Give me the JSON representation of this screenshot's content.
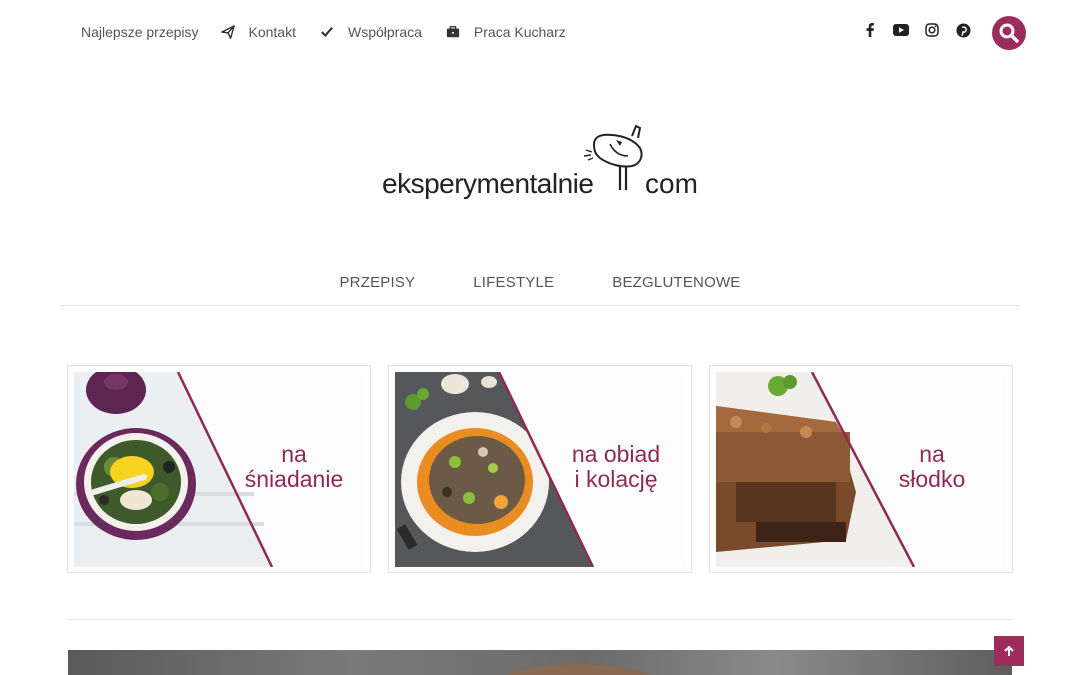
{
  "topnav": {
    "items": [
      {
        "label": "Najlepsze przepisy",
        "icon": "none"
      },
      {
        "label": "Kontakt",
        "icon": "paper-plane-icon"
      },
      {
        "label": "Współpraca",
        "icon": "check-icon"
      },
      {
        "label": "Praca Kucharz",
        "icon": "briefcase-icon"
      }
    ]
  },
  "social": [
    "facebook-icon",
    "youtube-icon",
    "instagram-icon",
    "pinterest-icon"
  ],
  "logo": {
    "text": "eksperymentalnie",
    "suffix": "com"
  },
  "mainnav": {
    "items": [
      "PRZEPISY",
      "LIFESTYLE",
      "BEZGLUTENOWE"
    ]
  },
  "cards": [
    {
      "line1": "na",
      "line2": "śniadanie"
    },
    {
      "line1": "na obiad",
      "line2": "i kolację"
    },
    {
      "line1": "na",
      "line2": "słodko"
    }
  ],
  "colors": {
    "accent": "#9c2d5b",
    "label": "#8f2a55"
  }
}
